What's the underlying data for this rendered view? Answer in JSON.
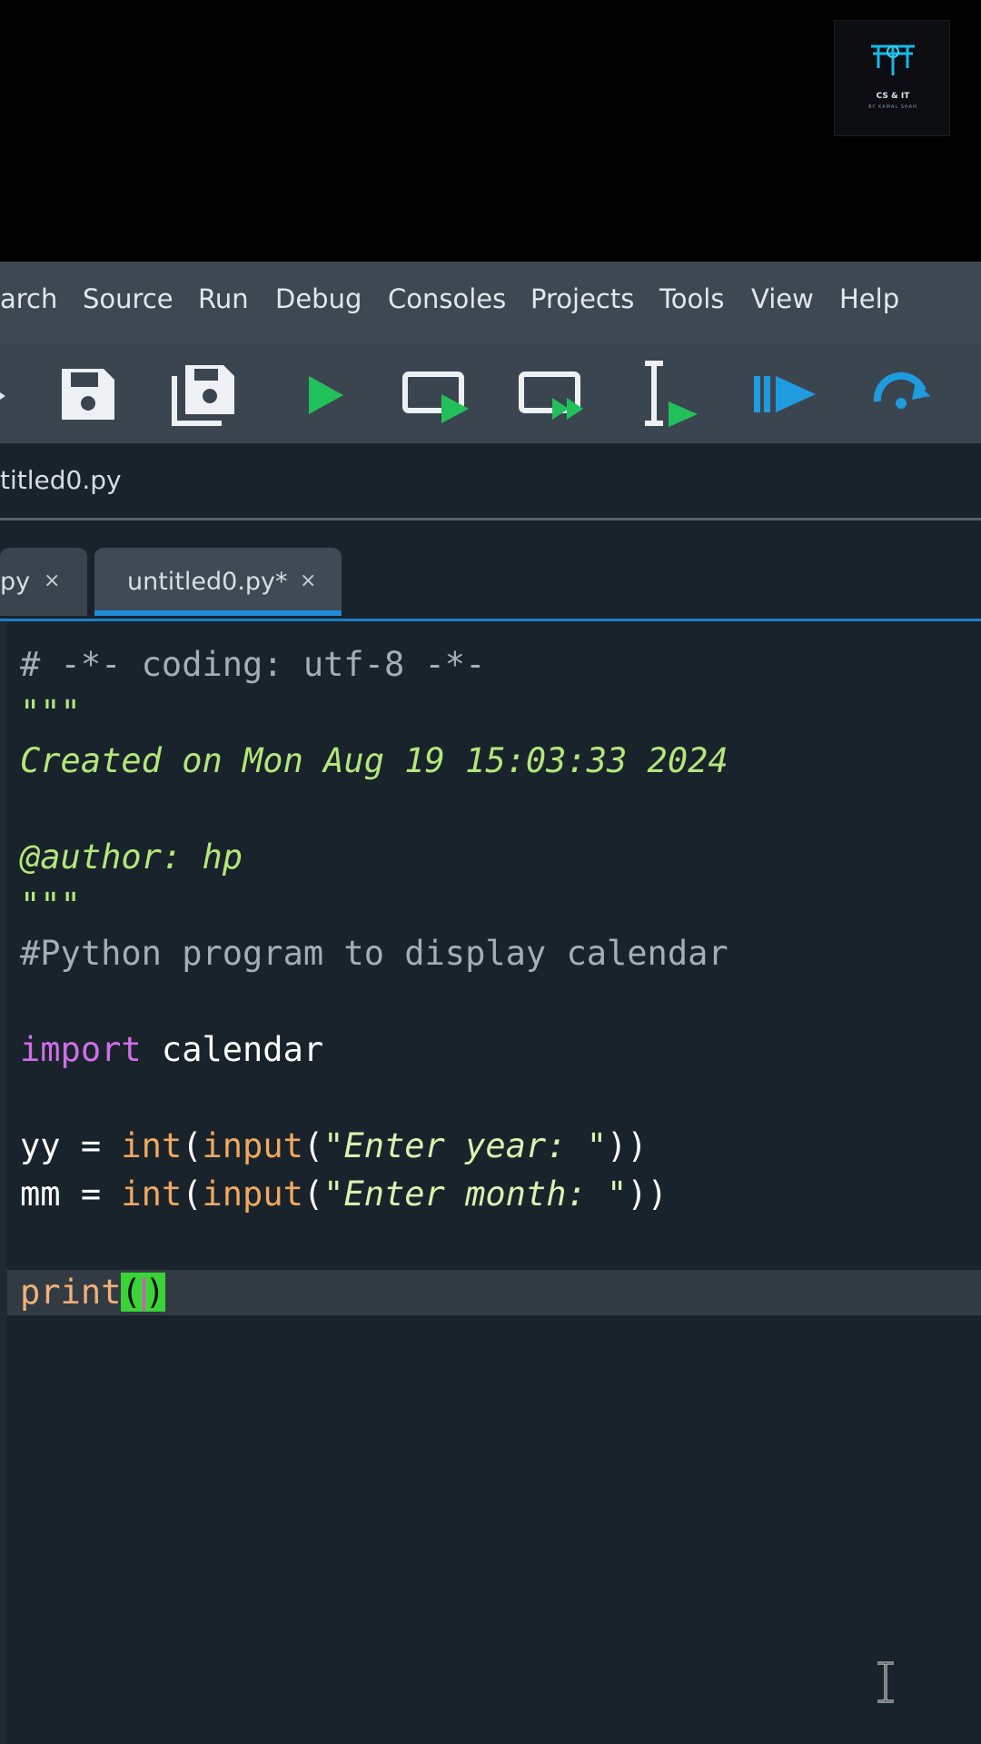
{
  "logo": {
    "text": "CS & IT",
    "sub": "BY KAMAL SHAH"
  },
  "menu": [
    "arch",
    "Source",
    "Run",
    "Debug",
    "Consoles",
    "Projects",
    "Tools",
    "View",
    "Help"
  ],
  "toolbar": {
    "icons": [
      "save-icon",
      "save-all-icon",
      "run-icon",
      "run-cell-icon",
      "run-cell-advance-icon",
      "run-selection-icon",
      "debug-icon",
      "step-icon"
    ]
  },
  "path": {
    "text": "titled0.py"
  },
  "tabs": [
    {
      "label": "py",
      "close": "×"
    },
    {
      "label": "untitled0.py*",
      "close": "×"
    }
  ],
  "code": {
    "line1": "# -*- coding: utf-8 -*-",
    "line2": "\"\"\"",
    "line3": "Created on Mon Aug 19 15:03:33 2024",
    "line5": "@author: hp",
    "line6": "\"\"\"",
    "line7": "#Python program to display calendar",
    "line9_kw": "import",
    "line9_rest": " calendar",
    "line11_a": "yy = ",
    "line11_int": "int",
    "line11_b": "(",
    "line11_input": "input",
    "line11_c": "(",
    "line11_str": "\"Enter year: \"",
    "line11_d": "))",
    "line12_a": "mm = ",
    "line12_int": "int",
    "line12_b": "(",
    "line12_input": "input",
    "line12_c": "(",
    "line12_str": "\"Enter month: \"",
    "line12_d": "))",
    "line14_fn": "print",
    "line14_open": "(",
    "line14_close": ")"
  },
  "colors": {
    "menubar": "#3e4852",
    "editor_bg": "#19232b",
    "tab_accent": "#1f8ad6",
    "run_green": "#22c05a",
    "debug_blue": "#1f9be0"
  }
}
